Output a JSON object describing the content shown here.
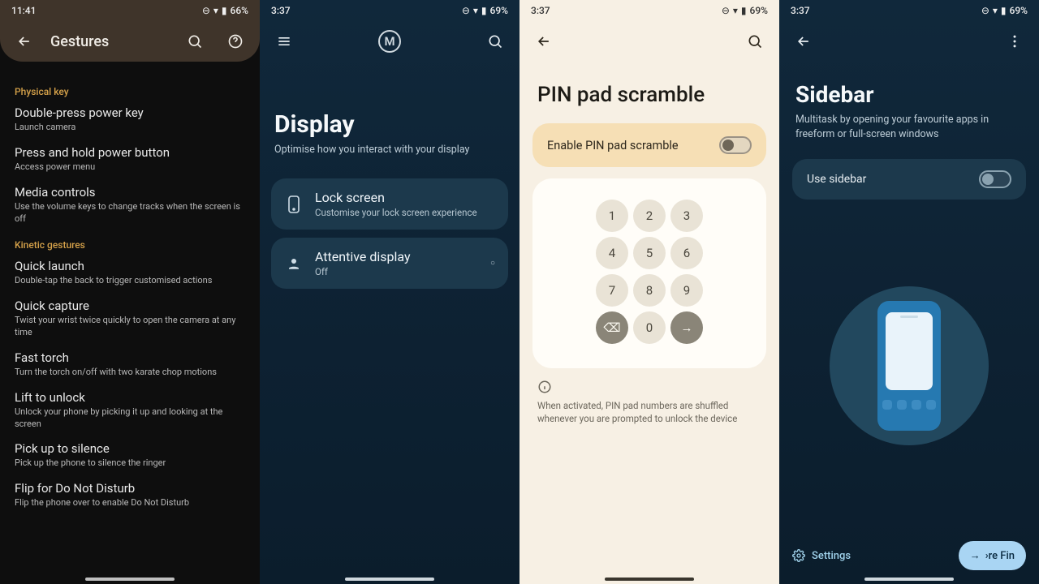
{
  "panel1": {
    "status": {
      "time": "11:41",
      "battery": "66%"
    },
    "toolbar_title": "Gestures",
    "sections": {
      "physical": {
        "header": "Physical key",
        "items": [
          {
            "title": "Double-press power key",
            "sub": "Launch camera"
          },
          {
            "title": "Press and hold power button",
            "sub": "Access power menu"
          },
          {
            "title": "Media controls",
            "sub": "Use the volume keys to change tracks when the screen is off"
          }
        ]
      },
      "kinetic": {
        "header": "Kinetic gestures",
        "items": [
          {
            "title": "Quick launch",
            "sub": "Double-tap the back to trigger customised actions"
          },
          {
            "title": "Quick capture",
            "sub": "Twist your wrist twice quickly to open the camera at any time"
          },
          {
            "title": "Fast torch",
            "sub": "Turn the torch on/off with two karate chop motions"
          },
          {
            "title": "Lift to unlock",
            "sub": "Unlock your phone by picking it up and looking at the screen"
          },
          {
            "title": "Pick up to silence",
            "sub": "Pick up the phone to silence the ringer"
          },
          {
            "title": "Flip for Do Not Disturb",
            "sub": "Flip the phone over to enable Do Not Disturb"
          }
        ]
      }
    }
  },
  "panel2": {
    "status": {
      "time": "3:37",
      "battery": "69%"
    },
    "logo_letter": "M",
    "title": "Display",
    "subtitle": "Optimise how you interact with your display",
    "rows": [
      {
        "title": "Lock screen",
        "sub": "Customise your lock screen experience"
      },
      {
        "title": "Attentive display",
        "sub": "Off"
      }
    ]
  },
  "panel3": {
    "status": {
      "time": "3:37",
      "battery": "69%"
    },
    "title": "PIN pad scramble",
    "toggle_label": "Enable PIN pad scramble",
    "keypad": [
      "1",
      "2",
      "3",
      "4",
      "5",
      "6",
      "7",
      "8",
      "9",
      "⌫",
      "0",
      "→"
    ],
    "info_text": "When activated, PIN pad numbers are shuffled whenever you are prompted to unlock the device"
  },
  "panel4": {
    "status": {
      "time": "3:37",
      "battery": "69%"
    },
    "title": "Sidebar",
    "subtitle": "Multitask by opening your favourite apps in freeform or full-screen windows",
    "toggle_label": "Use sidebar",
    "settings_label": "Settings",
    "finish_label": "›re   Fin"
  }
}
